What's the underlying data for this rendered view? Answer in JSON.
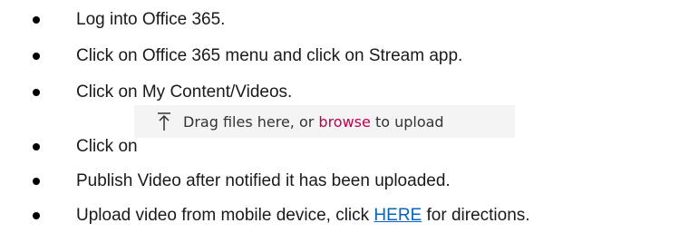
{
  "steps": [
    {
      "text": "Log into Office 365."
    },
    {
      "text": "Click on Office 365 menu and click on Stream app."
    },
    {
      "text": "Click on My Content/Videos."
    },
    {
      "text": "Click on"
    },
    {
      "text": "Publish Video after notified it has been uploaded."
    },
    {
      "text_before": "Upload video from mobile device, click ",
      "link": "HERE",
      "text_after": " for directions."
    }
  ],
  "upload_widget": {
    "icon": "upload-arrow-icon",
    "before": "Drag files here, or ",
    "browse": "browse",
    "after": " to upload"
  },
  "colors": {
    "link": "#0563c1",
    "browse": "#c0004f",
    "widget_background": "#f4f4f4"
  }
}
